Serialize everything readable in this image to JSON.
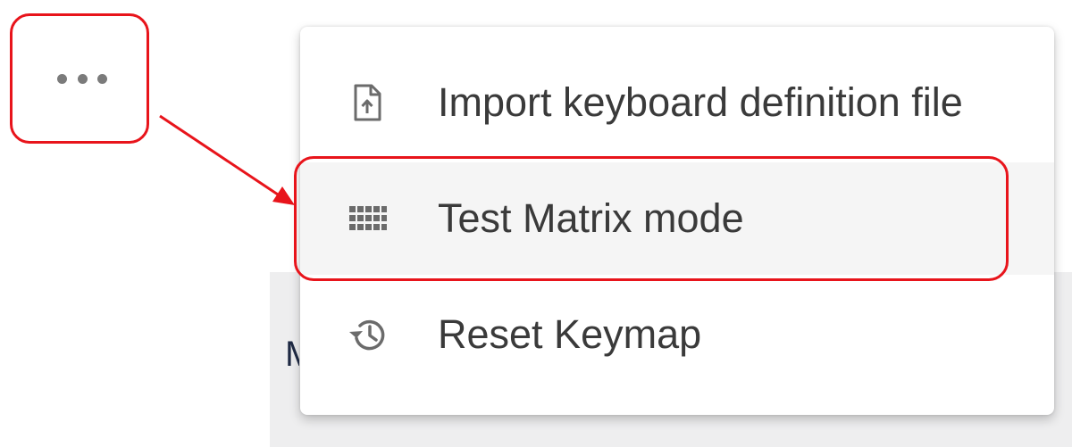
{
  "background": {
    "partial_text": "M"
  },
  "more_button": {
    "icon": "more-horizontal-icon"
  },
  "menu": {
    "items": [
      {
        "label": "Import keyboard definition file",
        "icon": "file-upload-icon",
        "highlighted": false
      },
      {
        "label": "Test Matrix mode",
        "icon": "grid-icon",
        "highlighted": true
      },
      {
        "label": "Reset Keymap",
        "icon": "history-icon",
        "highlighted": false
      }
    ]
  },
  "annotations": {
    "accent_color": "#e8141b"
  },
  "colors": {
    "menu_background": "#ffffff",
    "hover_background": "#f5f5f5",
    "text": "#3a3a3a",
    "icon": "#6b6b6b",
    "page_panel": "#eeeeef"
  }
}
